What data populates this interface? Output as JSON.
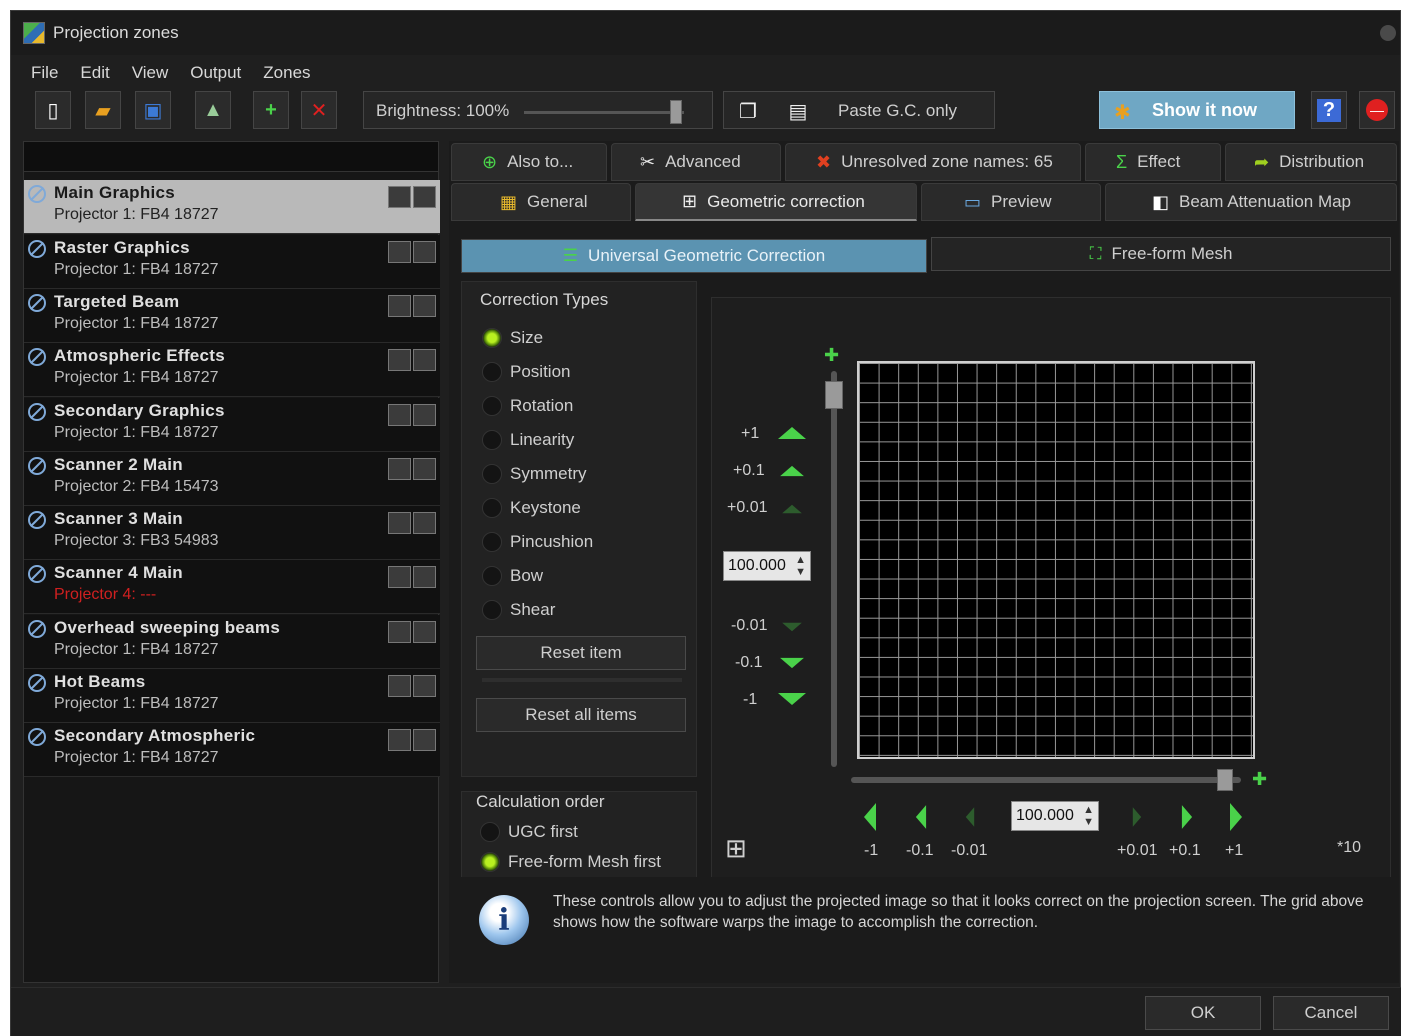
{
  "window": {
    "title": "Projection zones"
  },
  "menu": [
    "File",
    "Edit",
    "View",
    "Output",
    "Zones"
  ],
  "toolbar": {
    "brightness_label": "Brightness: 100%",
    "brightness_value": 100,
    "paste_label": "Paste G.C. only",
    "show_now_label": "Show it now"
  },
  "zones": [
    {
      "name": "Main Graphics",
      "projector": "Projector 1: FB4 18727",
      "selected": true,
      "error": false
    },
    {
      "name": "Raster Graphics",
      "projector": "Projector 1: FB4 18727",
      "selected": false,
      "error": false
    },
    {
      "name": "Targeted Beam",
      "projector": "Projector 1: FB4 18727",
      "selected": false,
      "error": false
    },
    {
      "name": "Atmospheric Effects",
      "projector": "Projector 1: FB4 18727",
      "selected": false,
      "error": false
    },
    {
      "name": "Secondary Graphics",
      "projector": "Projector 1: FB4 18727",
      "selected": false,
      "error": false
    },
    {
      "name": "Scanner 2 Main",
      "projector": "Projector 2: FB4 15473",
      "selected": false,
      "error": false
    },
    {
      "name": "Scanner 3 Main",
      "projector": "Projector 3: FB3 54983",
      "selected": false,
      "error": false
    },
    {
      "name": "Scanner 4 Main",
      "projector": "Projector 4: ---",
      "selected": false,
      "error": true
    },
    {
      "name": "Overhead sweeping beams",
      "projector": "Projector 1: FB4 18727",
      "selected": false,
      "error": false
    },
    {
      "name": "Hot Beams",
      "projector": "Projector 1: FB4 18727",
      "selected": false,
      "error": false
    },
    {
      "name": "Secondary Atmospheric",
      "projector": "Projector 1: FB4 18727",
      "selected": false,
      "error": false
    }
  ],
  "tabs_top": [
    {
      "label": "Also to...",
      "icon": "plus-circle-icon"
    },
    {
      "label": "Advanced",
      "icon": "tools-icon"
    },
    {
      "label": "Unresolved zone names: 65",
      "icon": "red-x-icon"
    },
    {
      "label": "Effect",
      "icon": "sigma-icon"
    },
    {
      "label": "Distribution",
      "icon": "distribution-arrow-icon"
    }
  ],
  "tabs_bottom": [
    {
      "label": "General",
      "icon": "general-icon"
    },
    {
      "label": "Geometric correction",
      "icon": "grid-icon",
      "active": true
    },
    {
      "label": "Preview",
      "icon": "monitor-icon"
    },
    {
      "label": "Beam Attenuation Map",
      "icon": "map-icon"
    }
  ],
  "subtabs": {
    "ugc": "Universal Geometric Correction",
    "mesh": "Free-form Mesh"
  },
  "correction": {
    "title": "Correction Types",
    "types": [
      "Size",
      "Position",
      "Rotation",
      "Linearity",
      "Symmetry",
      "Keystone",
      "Pincushion",
      "Bow",
      "Shear"
    ],
    "selected": "Size",
    "reset_item": "Reset item",
    "reset_all": "Reset all items"
  },
  "calc_order": {
    "title": "Calculation order",
    "options": [
      "UGC first",
      "Free-form Mesh first"
    ],
    "selected": "Free-form Mesh first"
  },
  "vertical_steps": {
    "up": [
      "+1",
      "+0.1",
      "+0.01"
    ],
    "down": [
      "-0.01",
      "-0.1",
      "-1"
    ],
    "value": "100.000"
  },
  "horizontal_steps": {
    "left": [
      "-1",
      "-0.1",
      "-0.01"
    ],
    "right": [
      "+0.01",
      "+0.1",
      "+1"
    ],
    "value": "100.000",
    "extra": "*10"
  },
  "info": {
    "text": "These controls allow you to adjust the projected image so that it looks correct on the projection screen. The grid above shows how the software warps the image to accomplish the correction."
  },
  "footer": {
    "ok": "OK",
    "cancel": "Cancel"
  },
  "colors": {
    "accent": "#5b93b1",
    "show_now": "#6fa7c4",
    "green": "#4ad24a",
    "error": "#d02020"
  }
}
